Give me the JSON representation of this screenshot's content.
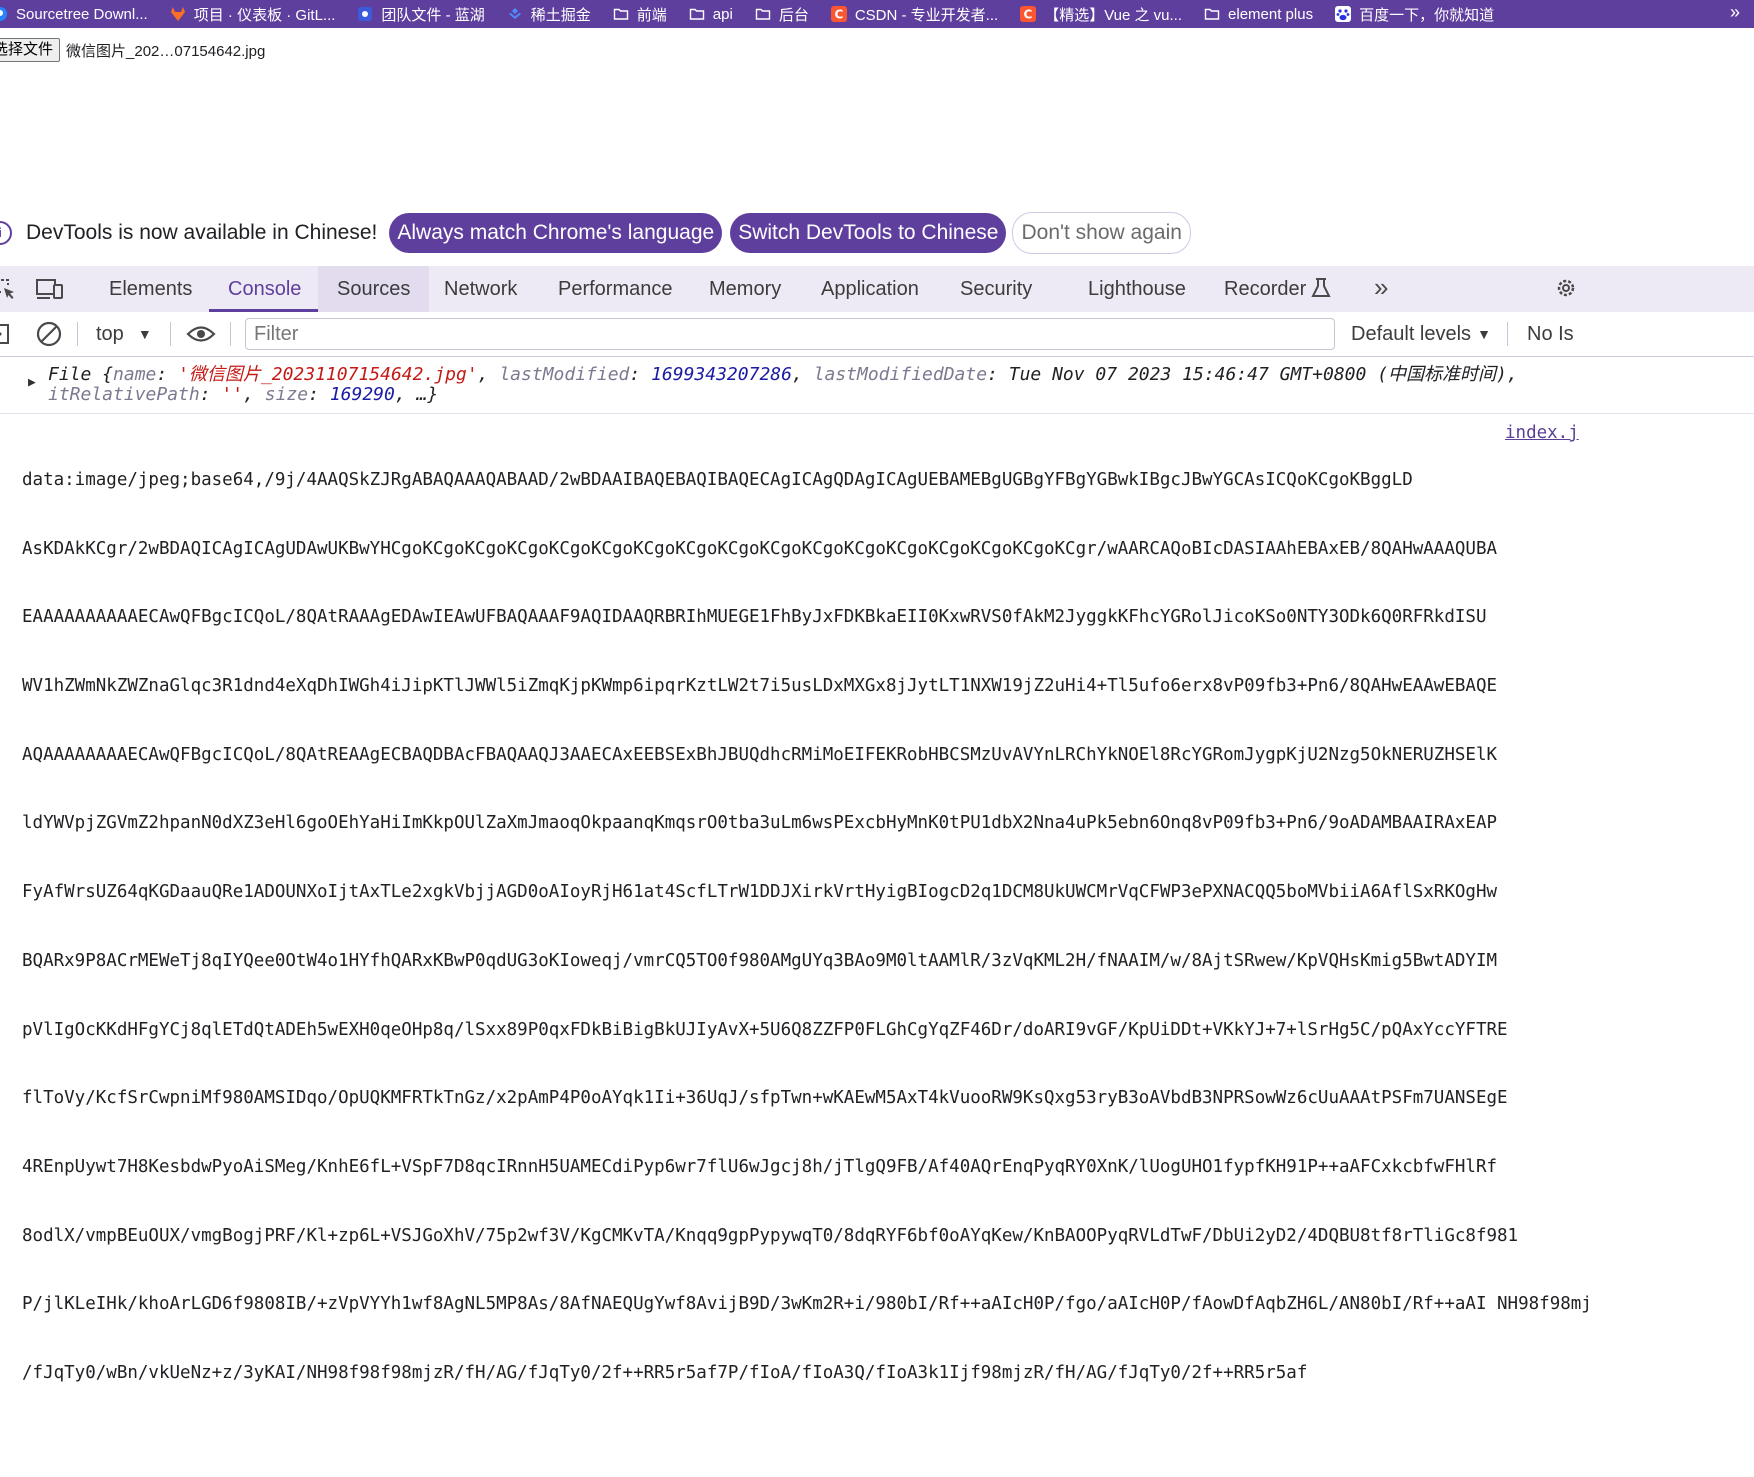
{
  "bookmarks": [
    {
      "label": "Sourcetree Downl...",
      "icon": "sourcetree-icon"
    },
    {
      "label": "项目 · 仪表板 · GitL...",
      "icon": "gitlab-icon"
    },
    {
      "label": "团队文件 - 蓝湖",
      "icon": "lanhu-icon"
    },
    {
      "label": "稀土掘金",
      "icon": "juejin-icon"
    },
    {
      "label": "前端",
      "icon": "folder-icon"
    },
    {
      "label": "api",
      "icon": "folder-icon"
    },
    {
      "label": "后台",
      "icon": "folder-icon"
    },
    {
      "label": "CSDN - 专业开发者...",
      "icon": "csdn-icon"
    },
    {
      "label": "【精选】Vue 之 vu...",
      "icon": "csdn-icon"
    },
    {
      "label": "element plus",
      "icon": "folder-icon"
    },
    {
      "label": "百度一下，你就知道",
      "icon": "baidu-icon"
    }
  ],
  "file_input": {
    "button_label": "选择文件",
    "file_name": "微信图片_202…07154642.jpg"
  },
  "banner": {
    "text": "DevTools is now available in Chinese!",
    "btn_always": "Always match Chrome's language",
    "btn_switch": "Switch DevTools to Chinese",
    "btn_dismiss": "Don't show again"
  },
  "tabs": [
    "Elements",
    "Console",
    "Sources",
    "Network",
    "Performance",
    "Memory",
    "Application",
    "Security",
    "Lighthouse",
    "Recorder"
  ],
  "console_toolbar": {
    "context": "top",
    "filter_placeholder": "Filter",
    "levels": "Default levels",
    "issues": "No Is"
  },
  "log_file": {
    "prefix": "File {",
    "k_name": "name",
    "v_name": "'微信图片_20231107154642.jpg'",
    "k_lastModified": "lastModified",
    "v_lastModified": "1699343207286",
    "k_lastModifiedDate": "lastModifiedDate",
    "v_lastModifiedDate": "Tue Nov 07 2023 15:46:47 GMT+0800 (中国标准时间),",
    "k_relpath": "itRelativePath",
    "v_relpath": "''",
    "k_size": "size",
    "v_size": "169290",
    "suffix": ", …}"
  },
  "log_data": {
    "source_link": "index.j",
    "lines": [
      "data:image/jpeg;base64,/9j/4AAQSkZJRgABAQAAAQABAAD/2wBDAAIBAQEBAQIBAQECAgICAgQDAgICAgUEBAMEBgUGBgYFBgYGBwkIBgcJBwYGCAsICQoKCgoKBggLD",
      "AsKDAkKCgr/2wBDAQICAgICAgUDAwUKBwYHCgoKCgoKCgoKCgoKCgoKCgoKCgoKCgoKCgoKCgoKCgoKCgoKCgoKCgoKCgoKCgoKCgr/wAARCAQoBIcDASIAAhEBAxEB/8QAHwAAAQUBA",
      "EAAAAAAAAAAECAwQFBgcICQoL/8QAtRAAAgEDAwIEAwUFBAQAAAF9AQIDAAQRBRIhMUEGE1FhByJxFDKBkaEII0KxwRVS0fAkM2JyggkKFhcYGRolJicoKSo0NTY3ODk6Q0RFRkdISU",
      "WV1hZWmNkZWZnaGlqc3R1dnd4eXqDhIWGh4iJipKTlJWWl5iZmqKjpKWmp6ipqrKztLW2t7i5usLDxMXGx8jJytLT1NXW19jZ2uHi4+Tl5ufo6erx8vP09fb3+Pn6/8QAHwEAAwEBAQE",
      "AQAAAAAAAAECAwQFBgcICQoL/8QAtREAAgECBAQDBAcFBAQAAQJ3AAECAxEEBSExBhJBUQdhcRMiMoEIFEKRobHBCSMzUvAVYnLRChYkNOEl8RcYGRomJygpKjU2Nzg5OkNERUZHSElK",
      "ldYWVpjZGVmZ2hpanN0dXZ3eHl6goOEhYaHiImKkpOUlZaXmJmaoqOkpaanqKmqsrO0tba3uLm6wsPExcbHyMnK0tPU1dbX2Nna4uPk5ebn6Onq8vP09fb3+Pn6/9oADAMBAAIRAxEAP",
      "FyAfWrsUZ64qKGDaauQRe1ADOUNXoIjtAxTLe2xgkVbjjAGD0oAIoyRjH61at4ScfLTrW1DDJXirkVrtHyigBIogcD2q1DCM8UkUWCMrVqCFWP3ePXNACQQ5boMVbiiA6AflSxRKOgHw",
      "BQARx9P8ACrMEWeTj8qIYQee0OtW4o1HYfhQARxKBwP0qdUG3oKIoweqj/vmrCQ5TO0f980AMgUYq3BAo9M0ltAAMlR/3zVqKML2H/fNAAIM/w/8AjtSRwew/KpVQHsKmig5BwtADYIM",
      "pVlIgOcKKdHFgYCj8qlETdQtADEh5wEXH0qeOHp8q/lSxx89P0qxFDkBiBigBkUJIyAvX+5U6Q8ZZFP0FLGhCgYqZF46Dr/doARI9vGF/KpUiDDt+VKkYJ+7+lSrHg5C/pQAxYccYFTRE",
      "flToVy/KcfSrCwpniMf980AMSIDqo/OpUQKMFRTkTnGz/x2pAmP4P0oAYqk1Ii+36UqJ/sfpTwn+wKAEwM5AxT4kVuooRW9KsQxg53ryB3oAVbdB3NPRSowWz6cUuAAAtPSFm7UANSEgE",
      "4REnpUywt7H8KesbdwPyoAiSMeg/KnhE6fL+VSpF7D8qcIRnnH5UAMECdiPyp6wr7flU6wJgcj8h/jTlgQ9FB/Af40AQrEnqPyqRY0XnK/lUogUHO1fypfKH91P++aAFCxkcbfwFHlRf",
      "8odlX/vmpBEuOUX/vmgBogjPRF/Kl+zp6L+VSJGoXhV/75p2wf3V/KgCMKvTA/Knqq9gpPypywqT0/8dqRYF6bf0oAYqKew/KnBAOOPyqRVLdTwF/DbUi2yD2/4DQBU8tf8rTliGc8f981",
      "P/jlKLeIHk/khoArLGD6f9808IB/+zVpVYYh1wf8AgNL5MP8As/8AfNAEQUgYwf8AvijB9D/3wKm2R+i/980bI/Rf++aAIcH0P/fgo/aAIcH0P/fAowDfAqbZH6L/AN80bI/Rf++aAI NH98f98mj",
      "/fJqTy0/wBn/vkUeNz+z/3yKAI/NH98f98f98mjzR/fH/AG/fJqTy0/2f++RR5r5af7P/fIoA/fIoA3Q/fIoA3k1Ijf98mjzR/fH/AG/fJqTy0/2f++RR5r5af"
    ]
  }
}
